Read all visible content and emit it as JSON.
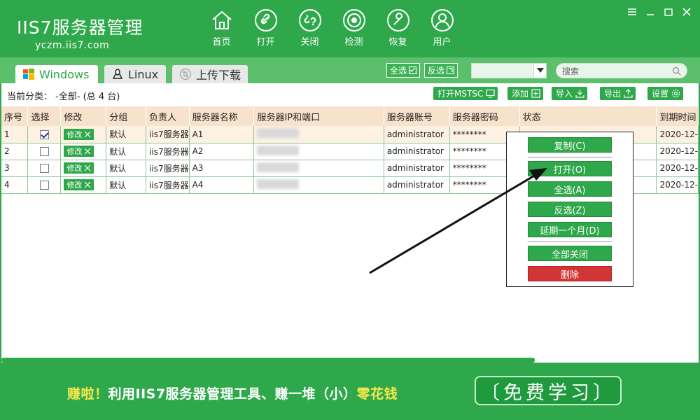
{
  "app": {
    "logo_main": "IIS7服务器管理",
    "logo_sub": "yczm.iis7.com"
  },
  "nav": {
    "items": [
      {
        "label": "首页",
        "icon": "home-icon"
      },
      {
        "label": "打开",
        "icon": "link-icon"
      },
      {
        "label": "关闭",
        "icon": "unlink-icon"
      },
      {
        "label": "检测",
        "icon": "target-icon"
      },
      {
        "label": "恢复",
        "icon": "wrench-icon"
      },
      {
        "label": "用户",
        "icon": "user-icon"
      }
    ]
  },
  "tabs": [
    {
      "label": "Windows",
      "icon": "windows-icon",
      "active": true
    },
    {
      "label": "Linux",
      "icon": "linux-icon",
      "active": false
    },
    {
      "label": "上传下载",
      "icon": "upload-icon",
      "active": false
    }
  ],
  "filter": {
    "select_all": "全选",
    "invert": "反选",
    "dropdown_value": "",
    "search_placeholder": "搜索"
  },
  "toolbar": {
    "category": "当前分类： -全部- (总 4 台)",
    "open_mstsc": "打开MSTSC",
    "add": "添加",
    "import": "导入",
    "export": "导出",
    "settings": "设置"
  },
  "table": {
    "columns": [
      "序号",
      "选择",
      "修改",
      "分组",
      "负责人",
      "服务器名称",
      "服务器IP和端口",
      "服务器账号",
      "服务器密码",
      "状态",
      "到期时间"
    ],
    "edit_label": "修改",
    "rows": [
      {
        "no": "1",
        "checked": true,
        "group": "默认",
        "owner": "iis7服务器",
        "name": "A1",
        "account": "administrator",
        "password": "********",
        "expire": "2020-12-"
      },
      {
        "no": "2",
        "checked": false,
        "group": "默认",
        "owner": "iis7服务器",
        "name": "A2",
        "account": "administrator",
        "password": "********",
        "expire": "2020-12-"
      },
      {
        "no": "3",
        "checked": false,
        "group": "默认",
        "owner": "iis7服务器",
        "name": "A3",
        "account": "administrator",
        "password": "********",
        "expire": "2020-12-"
      },
      {
        "no": "4",
        "checked": false,
        "group": "默认",
        "owner": "iis7服务器",
        "name": "A4",
        "account": "administrator",
        "password": "********",
        "expire": "2020-12-"
      }
    ]
  },
  "context_menu": {
    "copy": "复制(C)",
    "open": "打开(O)",
    "select_all": "全选(A)",
    "invert": "反选(Z)",
    "extend": "延期一个月(D)",
    "close_all": "全部关闭",
    "delete": "删除"
  },
  "banner": {
    "text_a": "赚啦！",
    "text_b": "利用IIS7服务器管理工具、赚一堆（小）",
    "text_c": "零花钱",
    "button": "〔免费学习〕"
  },
  "colors": {
    "brand_green": "#2ea84a",
    "tab_bar": "#5bbf6c",
    "header_row": "#f7e3cc",
    "delete_red": "#d13535",
    "highlight_yellow": "#f7e94d"
  }
}
